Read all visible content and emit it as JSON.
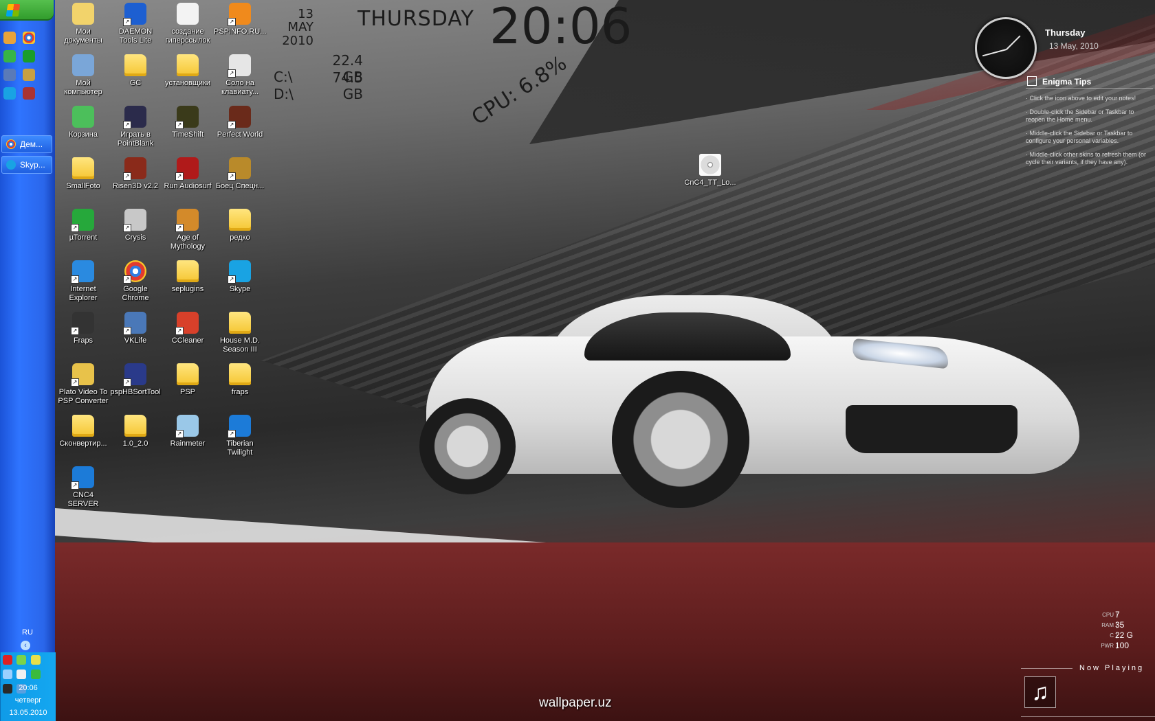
{
  "taskbar": {
    "tasks": [
      {
        "label": "Дем..."
      },
      {
        "label": "Skyp..."
      }
    ],
    "tray": {
      "language": "RU",
      "time": "20:06",
      "weekday": "четверг",
      "date": "13.05.2010"
    }
  },
  "desktop_icons": [
    {
      "label": "Мои документы",
      "icon": "my-documents-icon"
    },
    {
      "label": "DAEMON Tools Lite",
      "icon": "daemon-tools-icon"
    },
    {
      "label": "создание гиперссылок",
      "icon": "document-icon"
    },
    {
      "label": "PSPINFO.RU...",
      "icon": "vlc-cone-icon"
    },
    {
      "label": "Мой компьютер",
      "icon": "my-computer-icon"
    },
    {
      "label": "GC",
      "icon": "folder-icon"
    },
    {
      "label": "установщики",
      "icon": "folder-icon"
    },
    {
      "label": "Соло на клавиату...",
      "icon": "keyboard-solo-icon"
    },
    {
      "label": "Корзина",
      "icon": "recycle-bin-icon"
    },
    {
      "label": "Играть в PointBlank",
      "icon": "pointblank-icon"
    },
    {
      "label": "TimeShift",
      "icon": "timeshift-icon"
    },
    {
      "label": "Perfect World",
      "icon": "perfect-world-icon"
    },
    {
      "label": "SmallFoto",
      "icon": "folder-icon"
    },
    {
      "label": "Risen3D v2.2",
      "icon": "risen3d-icon"
    },
    {
      "label": "Run Audiosurf",
      "icon": "audiosurf-icon"
    },
    {
      "label": "Боец Спецн...",
      "icon": "spetsnaz-icon"
    },
    {
      "label": "µTorrent",
      "icon": "utorrent-icon"
    },
    {
      "label": "Crysis",
      "icon": "crysis-icon"
    },
    {
      "label": "Age of Mythology",
      "icon": "age-of-mythology-icon"
    },
    {
      "label": "редко",
      "icon": "folder-icon"
    },
    {
      "label": "Internet Explorer",
      "icon": "internet-explorer-icon"
    },
    {
      "label": "Google Chrome",
      "icon": "chrome-icon"
    },
    {
      "label": "seplugins",
      "icon": "folder-icon"
    },
    {
      "label": "Skype",
      "icon": "skype-icon"
    },
    {
      "label": "Fraps",
      "icon": "fraps-icon"
    },
    {
      "label": "VKLife",
      "icon": "vklife-icon"
    },
    {
      "label": "CCleaner",
      "icon": "ccleaner-icon"
    },
    {
      "label": "House M.D. Season III",
      "icon": "folder-icon"
    },
    {
      "label": "Plato Video To PSP Converter",
      "icon": "plato-converter-icon"
    },
    {
      "label": "pspHBSortTool",
      "icon": "psp-icon"
    },
    {
      "label": "PSP",
      "icon": "folder-icon"
    },
    {
      "label": "fraps",
      "icon": "folder-icon"
    },
    {
      "label": "Сконвертир...",
      "icon": "folder-icon"
    },
    {
      "label": "1.0_2.0",
      "icon": "folder-icon"
    },
    {
      "label": "Rainmeter",
      "icon": "rainmeter-icon"
    },
    {
      "label": "Tiberian Twilight",
      "icon": "cnc4-icon"
    },
    {
      "label": "CNC4 SERVER",
      "icon": "cnc4-icon"
    },
    {
      "label": "CnC4_TT_Lo...",
      "icon": "disc-file-icon"
    }
  ],
  "rainmeter": {
    "day": "THURSDAY",
    "time": "20:06",
    "date_day": "13",
    "date_month": "MAY",
    "date_year": "2010",
    "drives": [
      {
        "letter": "C:\\",
        "value": "22.4 GB"
      },
      {
        "letter": "D:\\",
        "value": "74.5 GB"
      }
    ],
    "cpu": "CPU: 6.8%"
  },
  "clock_widget": {
    "day": "Thursday",
    "date": "13 May, 2010"
  },
  "enigma_tips": {
    "title": "Enigma Tips",
    "tips": [
      "· Click the icon above to edit your notes!",
      "· Double-click the Sidebar or Taskbar to reopen the Home menu.",
      "· Middle-click the Sidebar or Taskbar to configure your personal variables.",
      "· Middle-click other skins to refresh them (or cycle their variants, if they have any)."
    ]
  },
  "system_stats": [
    {
      "key": "CPU",
      "value": "7"
    },
    {
      "key": "RAM",
      "value": "35"
    },
    {
      "key": "C",
      "value": "22 G"
    },
    {
      "key": "PWR",
      "value": "100"
    }
  ],
  "now_playing": {
    "label": "Now Playing"
  },
  "watermark": "wallpaper.uz",
  "colors": {
    "taskbar": "#2a66ea",
    "start": "#3aa834",
    "tray": "#12a2ec"
  }
}
